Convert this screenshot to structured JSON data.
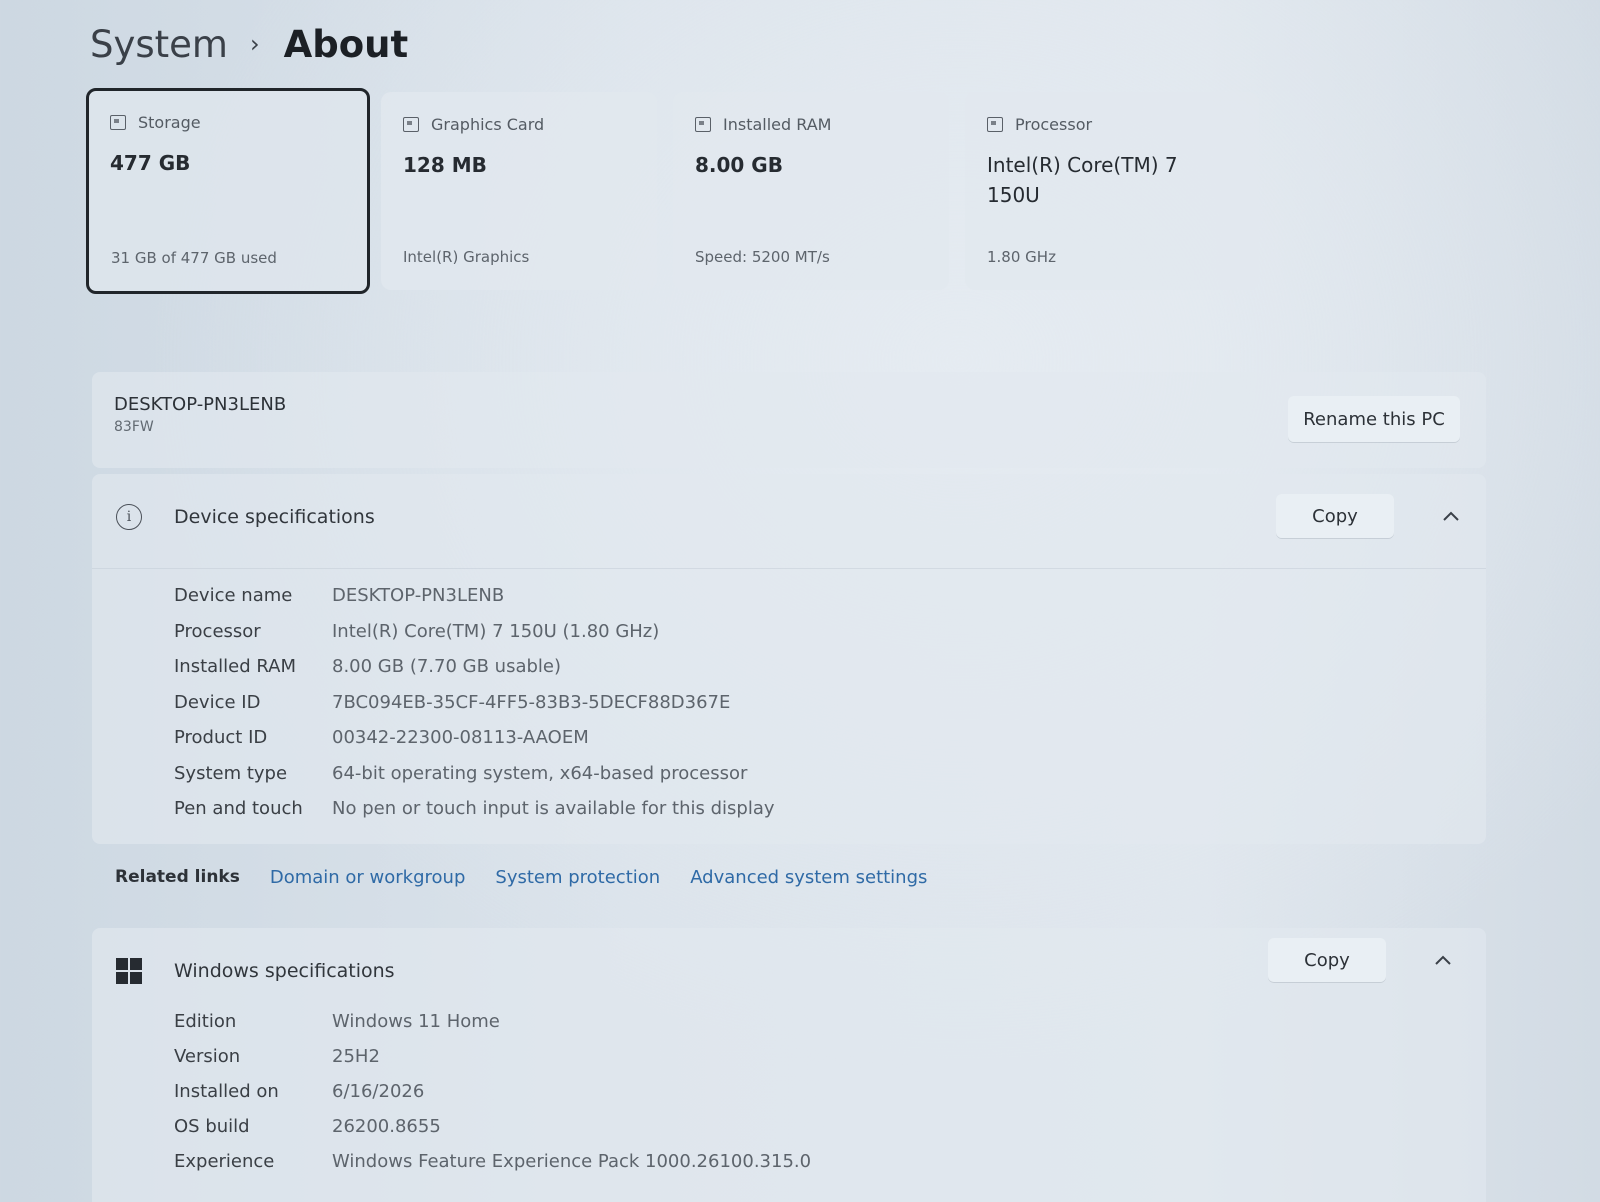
{
  "breadcrumb": {
    "parent": "System",
    "separator": "›",
    "current": "About"
  },
  "cards": [
    {
      "label": "Storage",
      "value": "477 GB",
      "sub": "31 GB of 477 GB used",
      "icon": "storage-icon"
    },
    {
      "label": "Graphics Card",
      "value": "128 MB",
      "sub": "Intel(R) Graphics",
      "icon": "graphics-card-icon"
    },
    {
      "label": "Installed RAM",
      "value": "8.00 GB",
      "sub": "Speed: 5200 MT/s",
      "icon": "ram-icon"
    },
    {
      "label": "Processor",
      "value": "Intel(R) Core(TM) 7 150U",
      "sub": "1.80 GHz",
      "icon": "processor-icon"
    }
  ],
  "pc": {
    "name": "DESKTOP-PN3LENB",
    "model": "83FW",
    "rename_label": "Rename this PC"
  },
  "device_specs": {
    "title": "Device specifications",
    "copy_label": "Copy",
    "rows": [
      {
        "label": "Device name",
        "value": "DESKTOP-PN3LENB"
      },
      {
        "label": "Processor",
        "value": "Intel(R) Core(TM) 7 150U (1.80 GHz)"
      },
      {
        "label": "Installed RAM",
        "value": "8.00 GB (7.70 GB usable)"
      },
      {
        "label": "Device ID",
        "value": "7BC094EB-35CF-4FF5-83B3-5DECF88D367E"
      },
      {
        "label": "Product ID",
        "value": "00342-22300-08113-AAOEM"
      },
      {
        "label": "System type",
        "value": "64-bit operating system, x64-based processor"
      },
      {
        "label": "Pen and touch",
        "value": "No pen or touch input is available for this display"
      }
    ]
  },
  "related_links": {
    "label": "Related links",
    "links": [
      "Domain or workgroup",
      "System protection",
      "Advanced system settings"
    ]
  },
  "windows_specs": {
    "title": "Windows specifications",
    "copy_label": "Copy",
    "rows": [
      {
        "label": "Edition",
        "value": "Windows 11 Home"
      },
      {
        "label": "Version",
        "value": "25H2"
      },
      {
        "label": "Installed on",
        "value": "6/16/2026"
      },
      {
        "label": "OS build",
        "value": "26200.8655"
      },
      {
        "label": "Experience",
        "value": "Windows Feature Experience Pack 1000.26100.315.0"
      }
    ]
  },
  "colors": {
    "link": "#2f6aa6",
    "selected_border": "#20252a"
  }
}
